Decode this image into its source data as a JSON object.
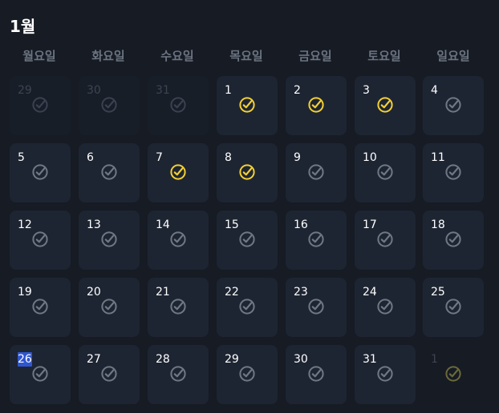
{
  "month_title": "1월",
  "weekdays": [
    "월요일",
    "화요일",
    "수요일",
    "목요일",
    "금요일",
    "토요일",
    "일요일"
  ],
  "colors": {
    "done": "#f3d034",
    "pending": "#6f7884",
    "other_month": "#3a4150",
    "next_month_done": "#6a6a3a"
  },
  "check_icon_name": "circle-check-icon",
  "weeks": [
    [
      {
        "day": "29",
        "month": "prev",
        "done": false
      },
      {
        "day": "30",
        "month": "prev",
        "done": false
      },
      {
        "day": "31",
        "month": "prev",
        "done": false
      },
      {
        "day": "1",
        "month": "current",
        "done": true
      },
      {
        "day": "2",
        "month": "current",
        "done": true
      },
      {
        "day": "3",
        "month": "current",
        "done": true
      },
      {
        "day": "4",
        "month": "current",
        "done": false
      }
    ],
    [
      {
        "day": "5",
        "month": "current",
        "done": false
      },
      {
        "day": "6",
        "month": "current",
        "done": false
      },
      {
        "day": "7",
        "month": "current",
        "done": true
      },
      {
        "day": "8",
        "month": "current",
        "done": true
      },
      {
        "day": "9",
        "month": "current",
        "done": false
      },
      {
        "day": "10",
        "month": "current",
        "done": false
      },
      {
        "day": "11",
        "month": "current",
        "done": false
      }
    ],
    [
      {
        "day": "12",
        "month": "current",
        "done": false
      },
      {
        "day": "13",
        "month": "current",
        "done": false
      },
      {
        "day": "14",
        "month": "current",
        "done": false
      },
      {
        "day": "15",
        "month": "current",
        "done": false
      },
      {
        "day": "16",
        "month": "current",
        "done": false
      },
      {
        "day": "17",
        "month": "current",
        "done": false
      },
      {
        "day": "18",
        "month": "current",
        "done": false
      }
    ],
    [
      {
        "day": "19",
        "month": "current",
        "done": false
      },
      {
        "day": "20",
        "month": "current",
        "done": false
      },
      {
        "day": "21",
        "month": "current",
        "done": false
      },
      {
        "day": "22",
        "month": "current",
        "done": false
      },
      {
        "day": "23",
        "month": "current",
        "done": false
      },
      {
        "day": "24",
        "month": "current",
        "done": false
      },
      {
        "day": "25",
        "month": "current",
        "done": false
      }
    ],
    [
      {
        "day": "26",
        "month": "current",
        "done": false,
        "selected": true
      },
      {
        "day": "27",
        "month": "current",
        "done": false
      },
      {
        "day": "28",
        "month": "current",
        "done": false
      },
      {
        "day": "29",
        "month": "current",
        "done": false
      },
      {
        "day": "30",
        "month": "current",
        "done": false
      },
      {
        "day": "31",
        "month": "current",
        "done": false
      },
      {
        "day": "1",
        "month": "next",
        "done": true
      }
    ]
  ]
}
